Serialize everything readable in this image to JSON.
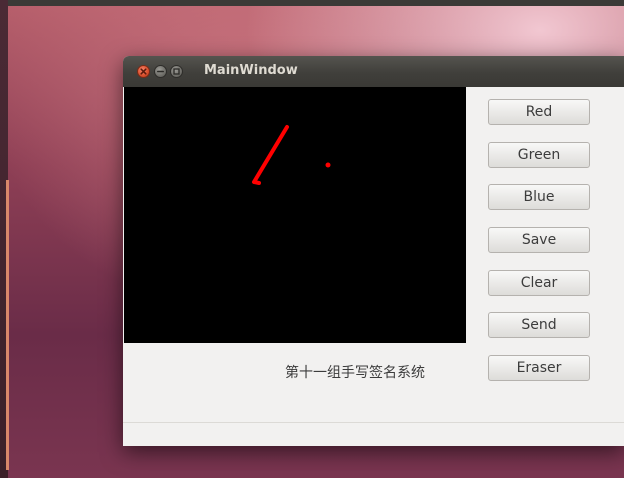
{
  "window": {
    "title": "MainWindow"
  },
  "canvas": {
    "background": "#000000",
    "ink_color": "#ff0000"
  },
  "buttons": [
    {
      "id": "red",
      "label": "Red"
    },
    {
      "id": "green",
      "label": "Green"
    },
    {
      "id": "blue",
      "label": "Blue"
    },
    {
      "id": "save",
      "label": "Save"
    },
    {
      "id": "clear",
      "label": "Clear"
    },
    {
      "id": "send",
      "label": "Send"
    },
    {
      "id": "eraser",
      "label": "Eraser"
    }
  ],
  "label": {
    "text": "第十一组手写签名系统"
  },
  "icons": {
    "close": "close-icon",
    "minimize": "minimize-icon",
    "maximize": "maximize-icon"
  }
}
